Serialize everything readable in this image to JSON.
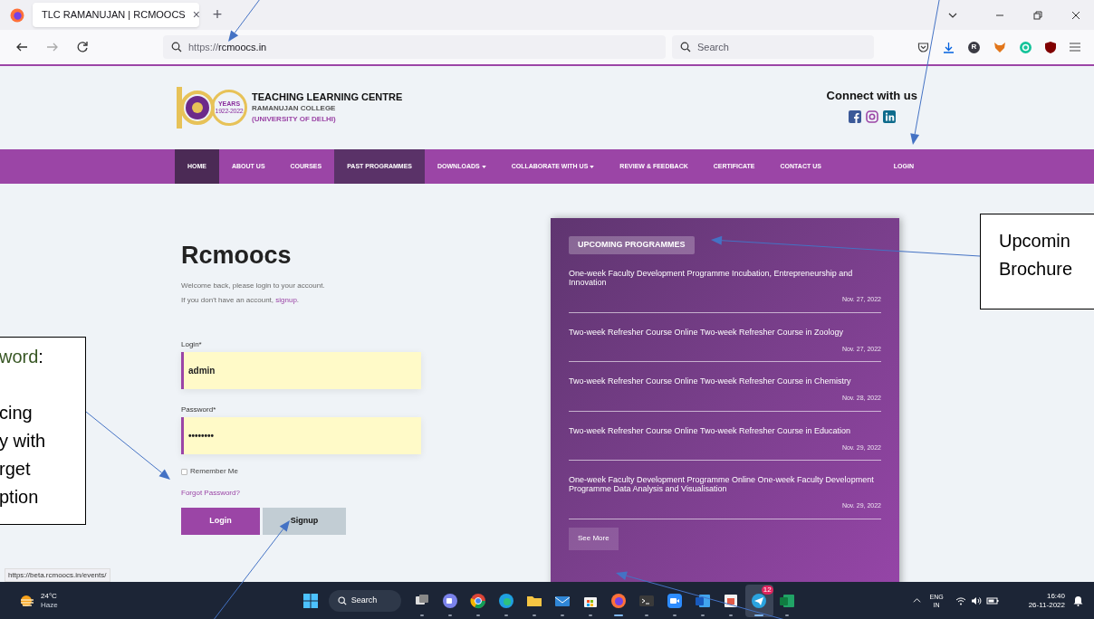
{
  "browser": {
    "tab": {
      "title": "TLC RAMANUJAN | RCMOOCS",
      "close": "×"
    },
    "new_tab": "+",
    "url": {
      "prefix": "https://",
      "host": "rcmoocs.in"
    },
    "search": {
      "placeholder": "Search"
    },
    "profile_initial": "R"
  },
  "site": {
    "logo": {
      "years": "YEARS",
      "span": "1922-2022"
    },
    "org": [
      "TEACHING LEARNING CENTRE",
      "RAMANUJAN COLLEGE",
      "(UNIVERSITY OF DELHI)"
    ],
    "connect": "Connect with us"
  },
  "nav": [
    {
      "label": "HOME",
      "selected": true,
      "hovered": false,
      "dropdown": false
    },
    {
      "label": "ABOUT US",
      "selected": false,
      "hovered": false,
      "dropdown": false
    },
    {
      "label": "COURSES",
      "selected": false,
      "hovered": false,
      "dropdown": false
    },
    {
      "label": "PAST PROGRAMMES",
      "selected": false,
      "hovered": true,
      "dropdown": false
    },
    {
      "label": "DOWNLOADS",
      "selected": false,
      "hovered": false,
      "dropdown": true
    },
    {
      "label": "COLLABORATE WITH US",
      "selected": false,
      "hovered": false,
      "dropdown": true
    },
    {
      "label": "REVIEW & FEEDBACK",
      "selected": false,
      "hovered": false,
      "dropdown": false
    },
    {
      "label": "CERTIFICATE",
      "selected": false,
      "hovered": false,
      "dropdown": false
    },
    {
      "label": "CONTACT US",
      "selected": false,
      "hovered": false,
      "dropdown": false
    }
  ],
  "nav_login": "LOGIN",
  "login_form": {
    "title": "Rcmoocs",
    "intro": "Welcome back, please login to your account.",
    "signup_prompt": "If you don't have an account,",
    "signup_link": "signup",
    "signup_end": ".",
    "fields": [
      {
        "label": "Login*",
        "value": "admin"
      },
      {
        "label": "Password*",
        "value": "••••••••"
      }
    ],
    "remember": {
      "label": "Remember Me",
      "checked": false
    },
    "forgot": "Forgot Password?",
    "buttons": [
      {
        "label": "Login",
        "kind": "primary"
      },
      {
        "label": "Signup",
        "kind": "secondary"
      }
    ]
  },
  "status_url": "https://beta.rcmoocs.in/events/",
  "upcoming": {
    "heading": "UPCOMING PROGRAMMES",
    "items": [
      {
        "title": "One-week Faculty Development Programme Incubation, Entrepreneurship and Innovation",
        "date": "Nov. 27, 2022"
      },
      {
        "title": "Two-week Refresher Course Online Two-week Refresher Course in Zoology",
        "date": "Nov. 27, 2022"
      },
      {
        "title": "Two-week Refresher Course Online Two-week Refresher Course in Chemistry",
        "date": "Nov. 28, 2022"
      },
      {
        "title": "Two-week Refresher Course Online Two-week Refresher Course in Education",
        "date": "Nov. 29, 2022"
      },
      {
        "title": "One-week Faculty Development Programme Online One-week Faculty Development Programme Data Analysis and Visualisation",
        "date": "Nov. 29, 2022"
      }
    ],
    "see_more": "See More"
  },
  "taskbar": {
    "temperature": "24°C",
    "weather": "Haze",
    "search": "Search",
    "telegram_badge": "12",
    "language": "ENG",
    "region": "IN",
    "time": "16:40",
    "date": "26-11-2022"
  },
  "callouts": [
    {
      "paragraphs": [
        [
          [
            {
              "text": "Upcomin"
            }
          ],
          [
            {
              "text": "Brochure"
            }
          ]
        ]
      ]
    },
    {
      "paragraphs": [
        [
          [
            {
              "text": "word",
              "color": "#375623"
            },
            {
              "text": ":"
            }
          ]
        ],
        [
          [
            {
              "text": "cing"
            }
          ],
          [
            {
              "text": "y with"
            }
          ],
          [
            {
              "text": "rget"
            }
          ],
          [
            {
              "text": "ption"
            }
          ]
        ]
      ]
    }
  ]
}
